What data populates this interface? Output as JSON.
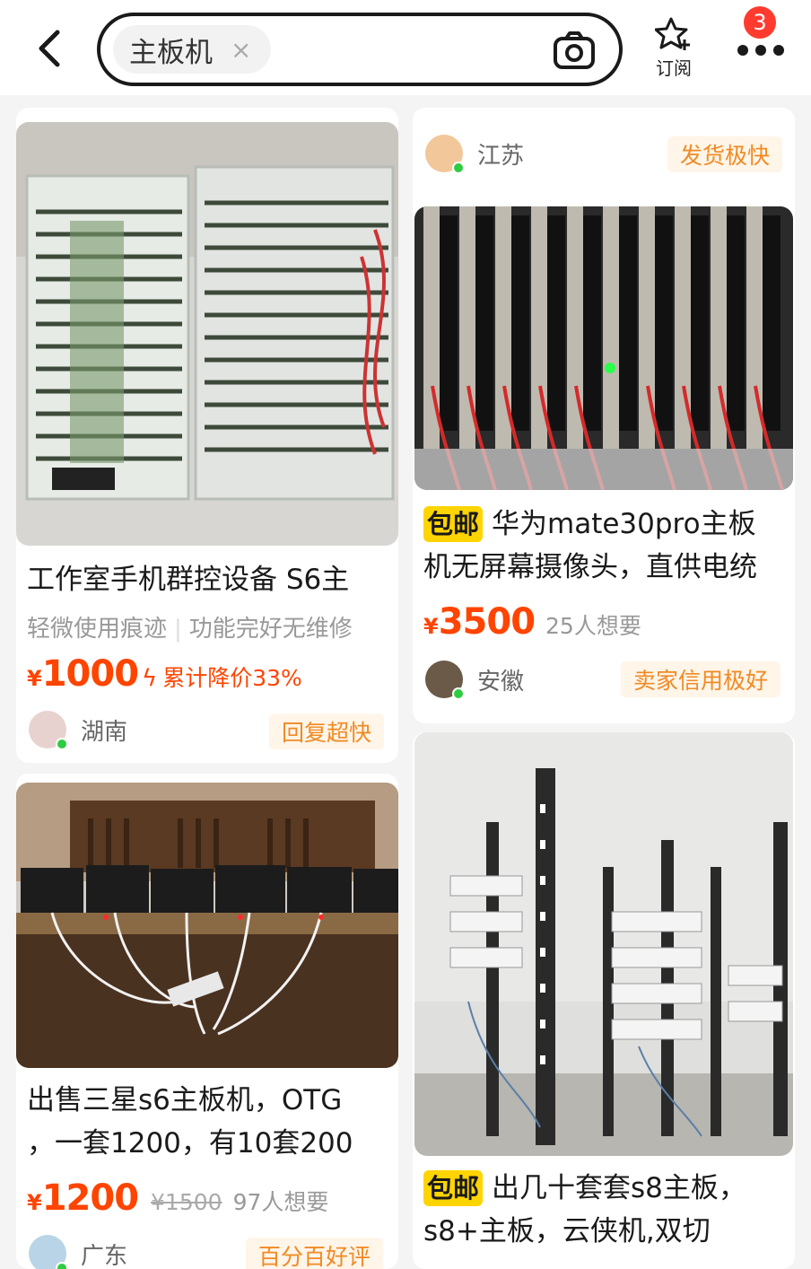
{
  "header": {
    "search_query": "主板机",
    "clear_symbol": "×",
    "subscribe_label": "订阅",
    "notification_count": "3"
  },
  "products": [
    {
      "title": "工作室手机群控设备 S6主",
      "tags": [
        "轻微使用痕迹",
        "功能完好无维修"
      ],
      "currency": "¥",
      "price": "1000",
      "price_drop": "累计降价33%",
      "location": "湖南",
      "seller_tag": "回复超快"
    },
    {
      "title": "出售三星s6主板机，OTG",
      "title_line2": "，一套1200，有10套200",
      "currency": "¥",
      "price": "1200",
      "original_price": "¥1500",
      "want_count": "97人想要",
      "location": "广东",
      "seller_tag": "百分百好评"
    },
    {
      "location": "江苏",
      "seller_tag": "发货极快"
    },
    {
      "badge": "包邮",
      "title": "华为mate30pro主板",
      "title_line2": "机无屏幕摄像头，直供电统",
      "currency": "¥",
      "price": "3500",
      "want_count": "25人想要",
      "location": "安徽",
      "seller_tag": "卖家信用极好"
    },
    {
      "badge": "包邮",
      "title": "出几十套套s8主板，",
      "title_line2": "s8+主板，云侠机,双切"
    }
  ],
  "colors": {
    "price": "#ff4400",
    "badge": "#ffd400",
    "seller_tag": "#f08a24",
    "online_dot": "#2ecc40",
    "notification": "#ff3b30"
  }
}
